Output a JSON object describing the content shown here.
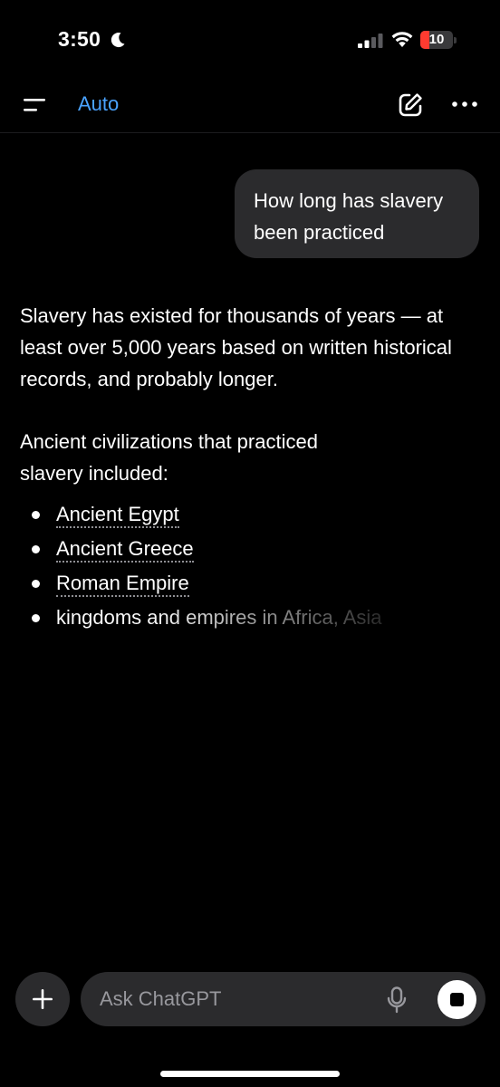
{
  "status_bar": {
    "time": "3:50",
    "battery_level": "10",
    "battery_fraction": 0.1
  },
  "header": {
    "model_label": "Auto",
    "icons": [
      "menu-icon",
      "compose-icon",
      "more-icon"
    ]
  },
  "conversation": {
    "user_message": "How long has slavery been practiced",
    "assistant": {
      "paragraph_1": "Slavery has existed for thousands of years — at least over 5,000 years based on written historical records, and probably longer.",
      "paragraph_2": "Ancient civilizations that practiced slavery included:",
      "bullets": [
        {
          "text": "Ancient Egypt",
          "is_link": true
        },
        {
          "text": "Ancient Greece",
          "is_link": true
        },
        {
          "text": "Roman Empire",
          "is_link": true
        },
        {
          "text": "kingdoms and empires in Africa, Asia",
          "is_link": false
        }
      ]
    }
  },
  "composer": {
    "placeholder": "Ask ChatGPT",
    "value": "",
    "icons": [
      "plus-icon",
      "mic-icon",
      "stop-icon"
    ]
  },
  "colors": {
    "background": "#000000",
    "bubble": "#2b2b2d",
    "accent": "#4aa3ff",
    "battery_low": "#ff3b30"
  }
}
